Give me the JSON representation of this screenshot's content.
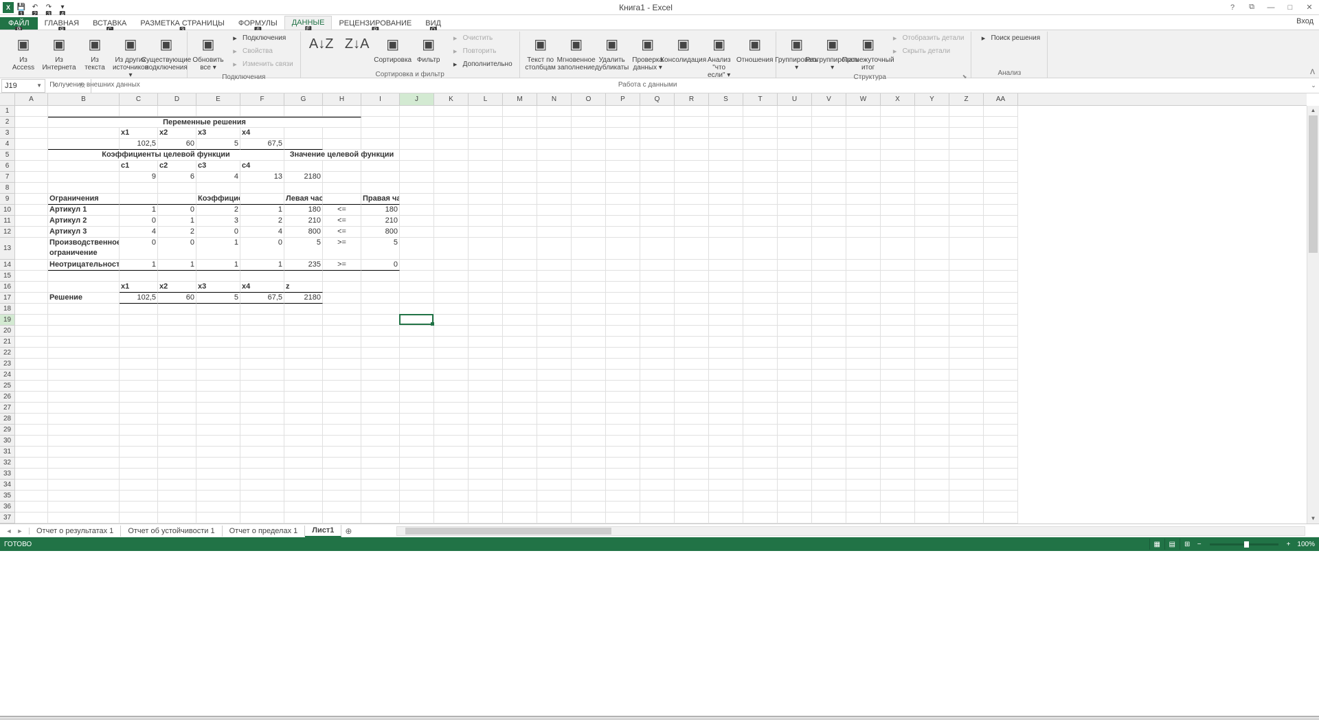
{
  "app": {
    "title": "Книга1 - Excel",
    "signin": "Вход"
  },
  "qat_keytips": [
    "1",
    "2",
    "3",
    "4"
  ],
  "tabs": {
    "file": "ФАЙЛ",
    "items": [
      {
        "label": "ГЛАВНАЯ",
        "key": "Я"
      },
      {
        "label": "ВСТАВКА",
        "key": "С"
      },
      {
        "label": "РАЗМЕТКА СТРАНИЦЫ",
        "key": "З"
      },
      {
        "label": "ФОРМУЛЫ",
        "key": "Л"
      },
      {
        "label": "ДАННЫЕ",
        "key": "Ё",
        "active": true
      },
      {
        "label": "РЕЦЕНЗИРОВАНИЕ",
        "key": "Р"
      },
      {
        "label": "ВИД",
        "key": "О"
      }
    ],
    "file_key": "Й"
  },
  "ribbon": {
    "groups": [
      {
        "label": "Получение внешних данных",
        "large": [
          {
            "id": "from-access",
            "label": "Из Access"
          },
          {
            "id": "from-web",
            "label": "Из Интернета"
          },
          {
            "id": "from-text",
            "label": "Из текста"
          },
          {
            "id": "from-other",
            "label": "Из других источников ▾"
          },
          {
            "id": "existing-conn",
            "label": "Существующие подключения"
          }
        ]
      },
      {
        "label": "Подключения",
        "large": [
          {
            "id": "refresh-all",
            "label": "Обновить все ▾"
          }
        ],
        "small": [
          {
            "id": "connections",
            "label": "Подключения"
          },
          {
            "id": "properties",
            "label": "Свойства",
            "disabled": true
          },
          {
            "id": "edit-links",
            "label": "Изменить связи",
            "disabled": true
          }
        ]
      },
      {
        "label": "Сортировка и фильтр",
        "large": [
          {
            "id": "sort-az",
            "label": "",
            "icon": "A↓Z"
          },
          {
            "id": "sort-za",
            "label": "",
            "icon": "Z↓A"
          },
          {
            "id": "sort",
            "label": "Сортировка"
          },
          {
            "id": "filter",
            "label": "Фильтр"
          }
        ],
        "small": [
          {
            "id": "clear",
            "label": "Очистить",
            "disabled": true
          },
          {
            "id": "reapply",
            "label": "Повторить",
            "disabled": true
          },
          {
            "id": "advanced",
            "label": "Дополнительно"
          }
        ]
      },
      {
        "label": "Работа с данными",
        "large": [
          {
            "id": "text-to-cols",
            "label": "Текст по столбцам"
          },
          {
            "id": "flash-fill",
            "label": "Мгновенное заполнение"
          },
          {
            "id": "remove-dup",
            "label": "Удалить дубликаты"
          },
          {
            "id": "data-valid",
            "label": "Проверка данных ▾"
          },
          {
            "id": "consolidate",
            "label": "Консолидация"
          },
          {
            "id": "whatif",
            "label": "Анализ \"что если\" ▾"
          },
          {
            "id": "relations",
            "label": "Отношения"
          }
        ]
      },
      {
        "label": "Структура",
        "large": [
          {
            "id": "group",
            "label": "Группировать ▾"
          },
          {
            "id": "ungroup",
            "label": "Разгруппировать ▾"
          },
          {
            "id": "subtotal",
            "label": "Промежуточный итог"
          }
        ],
        "small": [
          {
            "id": "show-detail",
            "label": "Отобразить детали",
            "disabled": true
          },
          {
            "id": "hide-detail",
            "label": "Скрыть детали",
            "disabled": true
          }
        ],
        "launcher": true
      },
      {
        "label": "Анализ",
        "small": [
          {
            "id": "solver",
            "label": "Поиск решения"
          }
        ]
      }
    ]
  },
  "namebox": "J19",
  "formula": "",
  "columns": [
    "A",
    "B",
    "C",
    "D",
    "E",
    "F",
    "G",
    "H",
    "I",
    "J",
    "K",
    "L",
    "M",
    "N",
    "O",
    "P",
    "Q",
    "R",
    "S",
    "T",
    "U",
    "V",
    "W",
    "X",
    "Y",
    "Z",
    "AA"
  ],
  "selected_col": "J",
  "selected_row": 19,
  "active_cell": {
    "col": 9,
    "row": 19
  },
  "data_rows": [
    {},
    {
      "B": {
        "t": "Переменные решения",
        "b": 1,
        "c": 1,
        "span": 7,
        "bt": 1
      }
    },
    {
      "C": {
        "t": "x1",
        "b": 1
      },
      "D": {
        "t": "x2",
        "b": 1
      },
      "E": {
        "t": "x3",
        "b": 1
      },
      "F": {
        "t": "x4",
        "b": 1
      }
    },
    {
      "C": {
        "t": "102,5",
        "r": 1,
        "bb": 1
      },
      "D": {
        "t": "60",
        "r": 1,
        "bb": 1
      },
      "E": {
        "t": "5",
        "r": 1,
        "bb": 1
      },
      "F": {
        "t": "67,5",
        "r": 1,
        "bb": 1
      },
      "B": {
        "bb": 1
      },
      "G": {
        "bb": 1
      }
    },
    {
      "B": {
        "t": "Коэффициенты целевой функции",
        "b": 1,
        "c": 1,
        "span": 5
      },
      "G": {
        "t": "Значение целевой функции",
        "b": 1,
        "c": 1,
        "span": 3
      }
    },
    {
      "C": {
        "t": "c1",
        "b": 1
      },
      "D": {
        "t": "c2",
        "b": 1
      },
      "E": {
        "t": "c3",
        "b": 1
      },
      "F": {
        "t": "c4",
        "b": 1
      }
    },
    {
      "C": {
        "t": "9",
        "r": 1
      },
      "D": {
        "t": "6",
        "r": 1
      },
      "E": {
        "t": "4",
        "r": 1
      },
      "F": {
        "t": "13",
        "r": 1
      },
      "G": {
        "t": "2180",
        "r": 1
      }
    },
    {},
    {
      "B": {
        "t": "Ограничения",
        "b": 1,
        "bb": 1
      },
      "E": {
        "t": "Коэффициенты",
        "b": 1,
        "c": 1,
        "bb": 1
      },
      "C": {
        "bb": 1
      },
      "D": {
        "bb": 1
      },
      "F": {
        "bb": 1
      },
      "G": {
        "t": "Левая часть",
        "b": 1,
        "r": 1,
        "bb": 1
      },
      "I": {
        "t": "Правая часть",
        "b": 1,
        "r": 1,
        "bb": 1
      },
      "H": {
        "bb": 1
      }
    },
    {
      "B": {
        "t": "Артикул 1",
        "b": 1
      },
      "C": {
        "t": "1",
        "r": 1
      },
      "D": {
        "t": "0",
        "r": 1
      },
      "E": {
        "t": "2",
        "r": 1
      },
      "F": {
        "t": "1",
        "r": 1
      },
      "G": {
        "t": "180",
        "r": 1
      },
      "H": {
        "t": "<=",
        "c": 1
      },
      "I": {
        "t": "180",
        "r": 1
      }
    },
    {
      "B": {
        "t": "Артикул 2",
        "b": 1
      },
      "C": {
        "t": "0",
        "r": 1
      },
      "D": {
        "t": "1",
        "r": 1
      },
      "E": {
        "t": "3",
        "r": 1
      },
      "F": {
        "t": "2",
        "r": 1
      },
      "G": {
        "t": "210",
        "r": 1
      },
      "H": {
        "t": "<=",
        "c": 1
      },
      "I": {
        "t": "210",
        "r": 1
      }
    },
    {
      "B": {
        "t": "Артикул 3",
        "b": 1
      },
      "C": {
        "t": "4",
        "r": 1
      },
      "D": {
        "t": "2",
        "r": 1
      },
      "E": {
        "t": "0",
        "r": 1
      },
      "F": {
        "t": "4",
        "r": 1
      },
      "G": {
        "t": "800",
        "r": 1
      },
      "H": {
        "t": "<=",
        "c": 1
      },
      "I": {
        "t": "800",
        "r": 1
      }
    },
    {
      "B": {
        "t": "Производственное ограничение",
        "b": 1,
        "h2": 1
      },
      "C": {
        "t": "0",
        "r": 1
      },
      "D": {
        "t": "0",
        "r": 1
      },
      "E": {
        "t": "1",
        "r": 1
      },
      "F": {
        "t": "0",
        "r": 1
      },
      "G": {
        "t": "5",
        "r": 1
      },
      "H": {
        "t": ">=",
        "c": 1
      },
      "I": {
        "t": "5",
        "r": 1
      }
    },
    {
      "B": {
        "t": "Неотрицательность",
        "b": 1,
        "bb": 1
      },
      "C": {
        "t": "1",
        "r": 1,
        "bb": 1
      },
      "D": {
        "t": "1",
        "r": 1,
        "bb": 1
      },
      "E": {
        "t": "1",
        "r": 1,
        "bb": 1
      },
      "F": {
        "t": "1",
        "r": 1,
        "bb": 1
      },
      "G": {
        "t": "235",
        "r": 1,
        "bb": 1
      },
      "H": {
        "t": ">=",
        "c": 1,
        "bb": 1
      },
      "I": {
        "t": "0",
        "r": 1,
        "bb": 1
      }
    },
    {},
    {
      "C": {
        "t": "x1",
        "b": 1,
        "bb": 1
      },
      "D": {
        "t": "x2",
        "b": 1,
        "bb": 1
      },
      "E": {
        "t": "x3",
        "b": 1,
        "bb": 1
      },
      "F": {
        "t": "x4",
        "b": 1,
        "bb": 1
      },
      "G": {
        "t": "z",
        "b": 1,
        "bb": 1
      }
    },
    {
      "B": {
        "t": "Решение",
        "b": 1
      },
      "C": {
        "t": "102,5",
        "r": 1,
        "bb": 1
      },
      "D": {
        "t": "60",
        "r": 1,
        "bb": 1
      },
      "E": {
        "t": "5",
        "r": 1,
        "bb": 1
      },
      "F": {
        "t": "67,5",
        "r": 1,
        "bb": 1
      },
      "G": {
        "t": "2180",
        "r": 1,
        "bb": 1
      }
    }
  ],
  "total_rows": 37,
  "sheets": [
    "Отчет о результатах 1",
    "Отчет об устойчивости 1",
    "Отчет о пределах 1",
    "Лист1"
  ],
  "active_sheet": 3,
  "status": "ГОТОВО",
  "zoom": "100%"
}
